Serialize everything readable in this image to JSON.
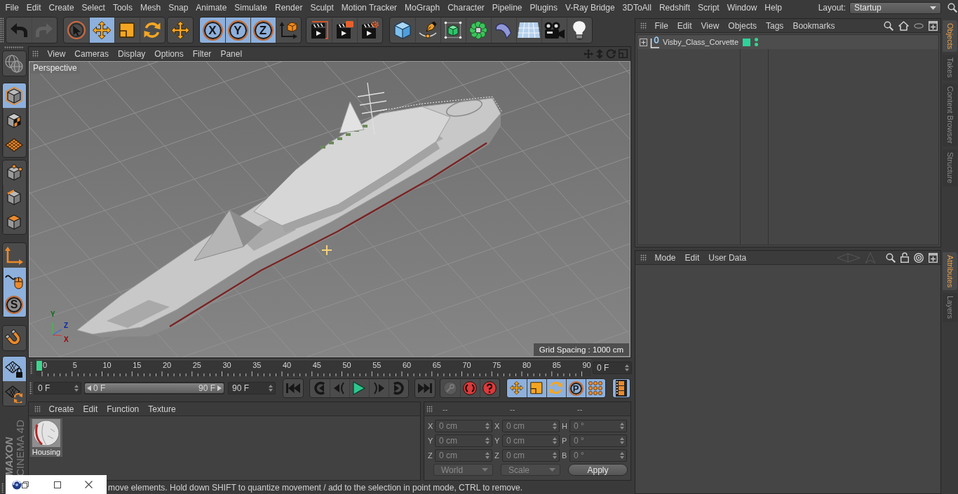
{
  "menu_bar": {
    "items": [
      "File",
      "Edit",
      "Create",
      "Select",
      "Tools",
      "Mesh",
      "Snap",
      "Animate",
      "Simulate",
      "Render",
      "Sculpt",
      "Motion Tracker",
      "MoGraph",
      "Character",
      "Pipeline",
      "Plugins",
      "V-Ray Bridge",
      "3DToAll",
      "Redshift",
      "Script",
      "Window",
      "Help"
    ],
    "layout": {
      "label": "Layout:",
      "value": "Startup"
    }
  },
  "toolbar": {
    "groups": [
      {
        "items": [
          {
            "selected": false,
            "disabled": false
          },
          {
            "selected": false,
            "disabled": true
          }
        ]
      },
      {
        "items": [
          {
            "selected": false,
            "disabled": false
          },
          {
            "selected": true,
            "disabled": false
          },
          {
            "selected": false,
            "disabled": false
          },
          {
            "selected": false,
            "disabled": false
          }
        ]
      },
      {
        "items": [
          {
            "selected": false,
            "disabled": false
          }
        ]
      },
      {
        "items": [
          {
            "label": "X",
            "selected": true,
            "disabled": false
          },
          {
            "label": "Y",
            "selected": true,
            "disabled": false
          },
          {
            "label": "Z",
            "selected": true,
            "disabled": false
          },
          {
            "selected": false,
            "disabled": false
          }
        ]
      },
      {
        "items": [
          {
            "selected": false,
            "disabled": false
          },
          {
            "selected": false,
            "disabled": false
          },
          {
            "selected": false,
            "disabled": false
          }
        ]
      },
      {
        "items": [
          {
            "selected": false,
            "disabled": false
          },
          {
            "selected": false,
            "disabled": false
          },
          {
            "selected": false,
            "disabled": false
          },
          {
            "selected": false,
            "disabled": false
          },
          {
            "selected": false,
            "disabled": false
          },
          {
            "selected": false,
            "disabled": false
          },
          {
            "selected": false,
            "disabled": false
          },
          {
            "selected": false,
            "disabled": false
          }
        ]
      }
    ]
  },
  "mode_toolbar": {
    "groups": [
      {
        "items": [
          {
            "selected": false
          }
        ]
      },
      {
        "items": [
          {
            "selected": true
          },
          {
            "selected": false
          },
          {
            "selected": false
          }
        ]
      },
      {
        "items": [
          {
            "selected": false
          },
          {
            "selected": false
          },
          {
            "selected": false
          }
        ]
      },
      {
        "items": [
          {
            "selected": false
          },
          {
            "selected": true
          },
          {
            "label": "S",
            "selected": true
          }
        ]
      },
      {
        "items": [
          {
            "selected": false
          }
        ]
      },
      {
        "items": [
          {
            "selected": true
          },
          {
            "selected": false
          }
        ]
      }
    ]
  },
  "logo": {
    "brand": "MAXON",
    "product": "CINEMA 4D"
  },
  "viewport": {
    "menu": [
      "View",
      "Cameras",
      "Display",
      "Options",
      "Filter",
      "Panel"
    ],
    "camera": "Perspective",
    "axis_labels": [
      "Y",
      "Z",
      "X"
    ],
    "grid_spacing": "Grid Spacing : 1000 cm"
  },
  "timeline": {
    "ruler_labels": [
      "0",
      "5",
      "10",
      "15",
      "20",
      "25",
      "30",
      "35",
      "40",
      "45",
      "50",
      "55",
      "60",
      "65",
      "70",
      "75",
      "80",
      "85",
      "90"
    ],
    "playhead": {
      "level": 0
    },
    "current_frame": "0 F",
    "start_frame": "0 F",
    "range": {
      "start": "0 F",
      "end": "90 F",
      "level": 1
    },
    "end_frame": "90 F",
    "transport": {
      "groups": [
        {
          "items": [
            {
              "selected": false,
              "disabled": false
            }
          ]
        },
        {
          "items": [
            {
              "selected": false,
              "disabled": false
            },
            {
              "selected": false,
              "disabled": false
            },
            {
              "selected": false,
              "disabled": false
            },
            {
              "selected": false,
              "disabled": false
            },
            {
              "selected": false,
              "disabled": false
            }
          ]
        },
        {
          "items": [
            {
              "selected": false,
              "disabled": false
            }
          ]
        },
        {
          "items": [
            {
              "selected": false,
              "disabled": true
            },
            {
              "selected": false,
              "disabled": false
            },
            {
              "selected": false,
              "disabled": false
            }
          ]
        },
        {
          "items": [
            {
              "selected": true,
              "disabled": false
            },
            {
              "selected": true,
              "disabled": false
            },
            {
              "selected": true,
              "disabled": false
            },
            {
              "label": "P",
              "selected": true,
              "disabled": false
            },
            {
              "selected": true,
              "disabled": false
            }
          ]
        },
        {
          "items": [
            {
              "selected": true,
              "disabled": false
            }
          ]
        }
      ]
    }
  },
  "material_manager": {
    "menu": [
      "Create",
      "Edit",
      "Function",
      "Texture"
    ],
    "materials": [
      {
        "name": "Housing"
      }
    ]
  },
  "coordinates": {
    "headers": [
      "--",
      "--",
      "--"
    ],
    "columns": [
      {
        "fields": [
          {
            "axis": "X",
            "value": "0 cm"
          },
          {
            "axis": "Y",
            "value": "0 cm"
          },
          {
            "axis": "Z",
            "value": "0 cm"
          }
        ]
      },
      {
        "fields": [
          {
            "axis": "X",
            "value": "0 cm"
          },
          {
            "axis": "Y",
            "value": "0 cm"
          },
          {
            "axis": "Z",
            "value": "0 cm"
          }
        ]
      },
      {
        "fields": [
          {
            "axis": "H",
            "value": "0 °"
          },
          {
            "axis": "P",
            "value": "0 °"
          },
          {
            "axis": "B",
            "value": "0 °"
          }
        ]
      }
    ],
    "disabled": true,
    "dropdowns": [
      "World",
      "Scale"
    ],
    "apply_button": "Apply"
  },
  "status_bar": {
    "text": "move elements. Hold down SHIFT to quantize movement / add to the selection in point mode, CTRL to remove."
  },
  "objects_manager": {
    "menu": [
      "File",
      "Edit",
      "View",
      "Objects",
      "Tags",
      "Bookmarks"
    ],
    "objects": [
      {
        "name": "Visby_Class_Corvette",
        "expanded": false,
        "color": "#2ed39a",
        "editor_visible": true,
        "render_visible": true
      }
    ]
  },
  "objects_tabs": [
    {
      "label": "Objects",
      "selected": true
    },
    {
      "label": "Takes",
      "selected": false
    },
    {
      "label": "Content Browser",
      "selected": false
    },
    {
      "label": "Structure",
      "selected": false
    }
  ],
  "attributes_manager": {
    "menu": [
      "Mode",
      "Edit",
      "User Data"
    ],
    "navigation": [
      {
        "disabled": true
      },
      {
        "disabled": true
      }
    ]
  },
  "attributes_tabs": [
    {
      "label": "Attributes",
      "selected": true
    },
    {
      "label": "Layers",
      "selected": false
    }
  ]
}
